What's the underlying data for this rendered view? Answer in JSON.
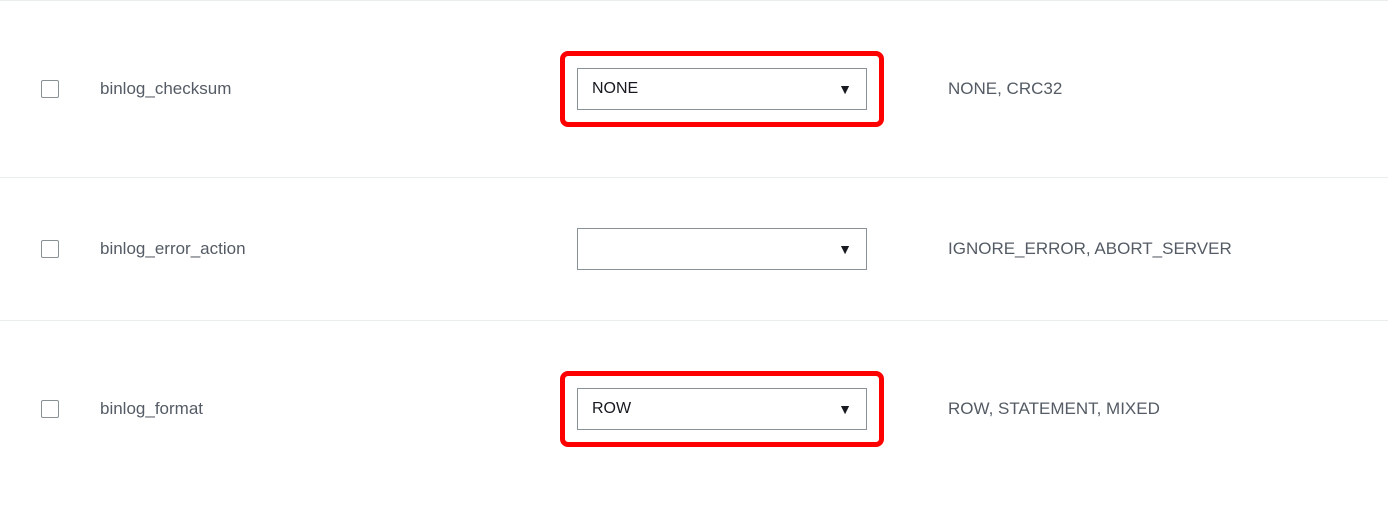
{
  "parameters": [
    {
      "name": "binlog_checksum",
      "value": "NONE",
      "allowed": "NONE, CRC32",
      "highlighted": true
    },
    {
      "name": "binlog_error_action",
      "value": "",
      "allowed": "IGNORE_ERROR, ABORT_SERVER",
      "highlighted": false
    },
    {
      "name": "binlog_format",
      "value": "ROW",
      "allowed": "ROW, STATEMENT, MIXED",
      "highlighted": true
    }
  ]
}
